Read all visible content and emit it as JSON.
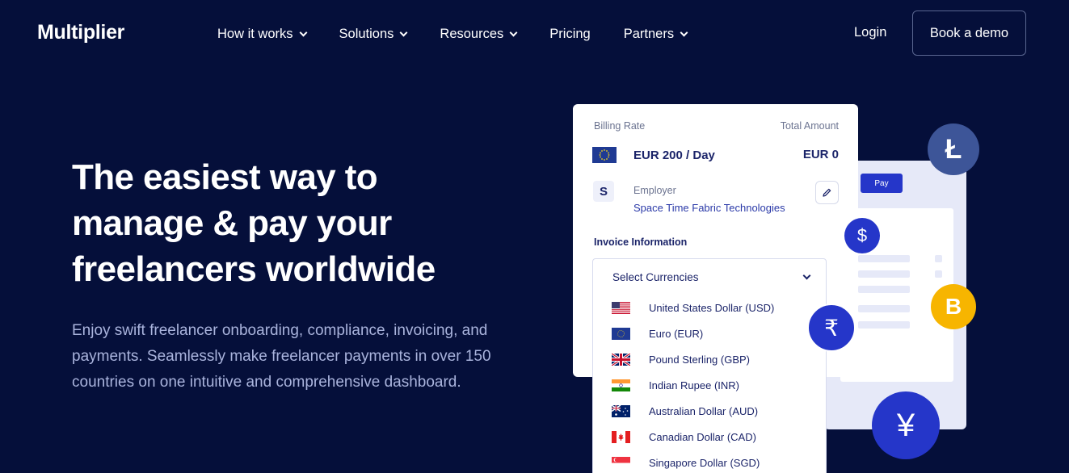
{
  "nav": {
    "logo": "Multiplier",
    "items": [
      {
        "label": "How it works",
        "has_dropdown": true
      },
      {
        "label": "Solutions",
        "has_dropdown": true
      },
      {
        "label": "Resources",
        "has_dropdown": true
      },
      {
        "label": "Pricing",
        "has_dropdown": false
      },
      {
        "label": "Partners",
        "has_dropdown": true
      }
    ],
    "login": "Login",
    "cta": "Book a demo"
  },
  "hero": {
    "title_line1": "The easiest way to",
    "title_line2": "manage & pay your",
    "title_line3": "freelancers worldwide",
    "subtitle": "Enjoy swift freelancer onboarding, compliance, invoicing, and payments. Seamlessly make freelancer payments in over 150 countries on one intuitive and comprehensive dashboard."
  },
  "invoice_card": {
    "billing_rate_label": "Billing Rate",
    "total_amount_label": "Total Amount",
    "rate": "EUR 200 / Day",
    "total": "EUR 0",
    "employer_initial": "S",
    "employer_label": "Employer",
    "employer_name": "Space Time Fabric Technologies",
    "invoice_info_label": "Invoice Information"
  },
  "back_card": {
    "pay_label": "Pay"
  },
  "currency_dropdown": {
    "placeholder": "Select Currencies",
    "options": [
      {
        "label": "United States Dollar (USD)",
        "flag": "us-flag"
      },
      {
        "label": "Euro (EUR)",
        "flag": "eu-flag"
      },
      {
        "label": "Pound Sterling (GBP)",
        "flag": "uk-flag"
      },
      {
        "label": "Indian Rupee (INR)",
        "flag": "india-flag"
      },
      {
        "label": "Australian Dollar (AUD)",
        "flag": "australia-flag"
      },
      {
        "label": "Canadian Dollar (CAD)",
        "flag": "canada-flag"
      },
      {
        "label": "Singapore Dollar (SGD)",
        "flag": "singapore-flag"
      }
    ]
  },
  "coins": {
    "litecoin": "Ł",
    "dollar": "$",
    "bitcoin": "B",
    "rupee": "₹",
    "yen": "¥"
  },
  "colors": {
    "background": "#050f3a",
    "accent": "#2536c9",
    "bitcoin": "#f7b500",
    "litecoin": "#3d5598",
    "subtitle": "#aab4dd"
  }
}
